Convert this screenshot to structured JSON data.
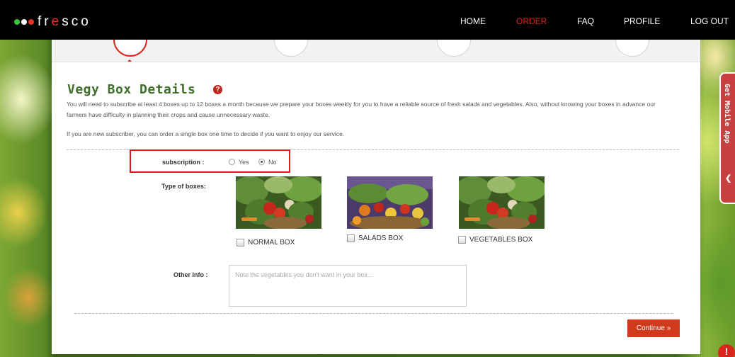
{
  "brand": {
    "logo_text": "fresco"
  },
  "nav": {
    "items": [
      {
        "label": "HOME"
      },
      {
        "label": "ORDER",
        "active": true
      },
      {
        "label": "FAQ"
      },
      {
        "label": "PROFILE"
      },
      {
        "label": "LOG OUT"
      }
    ],
    "active_color": "#d9261c"
  },
  "page": {
    "title": "Vegy Box Details",
    "description": "You will need to subscribe at least 4 boxes up to 12 boxes a month because we prepare your boxes weekly for you to have a reliable source of fresh salads and vegetables. Also, without knowing your boxes in advance our farmers have difficulty in planning their crops and cause unnecessary waste.",
    "description_2": "If you are new subscriber, you can order a single box one time to decide if you want to enjoy our service."
  },
  "form": {
    "subscription": {
      "label": "subscription :",
      "options": [
        {
          "label": "Yes",
          "checked": false
        },
        {
          "label": "No",
          "checked": true
        }
      ]
    },
    "type_of_boxes": {
      "label": "Type of boxes:",
      "boxes": [
        {
          "label": "NORMAL BOX",
          "checked": false
        },
        {
          "label": "SALADS BOX",
          "checked": false
        },
        {
          "label": "VEGETABLES BOX",
          "checked": false
        }
      ]
    },
    "other_info": {
      "label": "Other Info :",
      "placeholder": "Note the vegetables you don't want in your box..."
    },
    "continue_label": "Continue »"
  },
  "side_tab": {
    "label": "Get Mobile App"
  },
  "colors": {
    "brand_green": "#3f6f2a",
    "accent_red": "#d23a1e",
    "highlight_red": "#e1191f"
  }
}
